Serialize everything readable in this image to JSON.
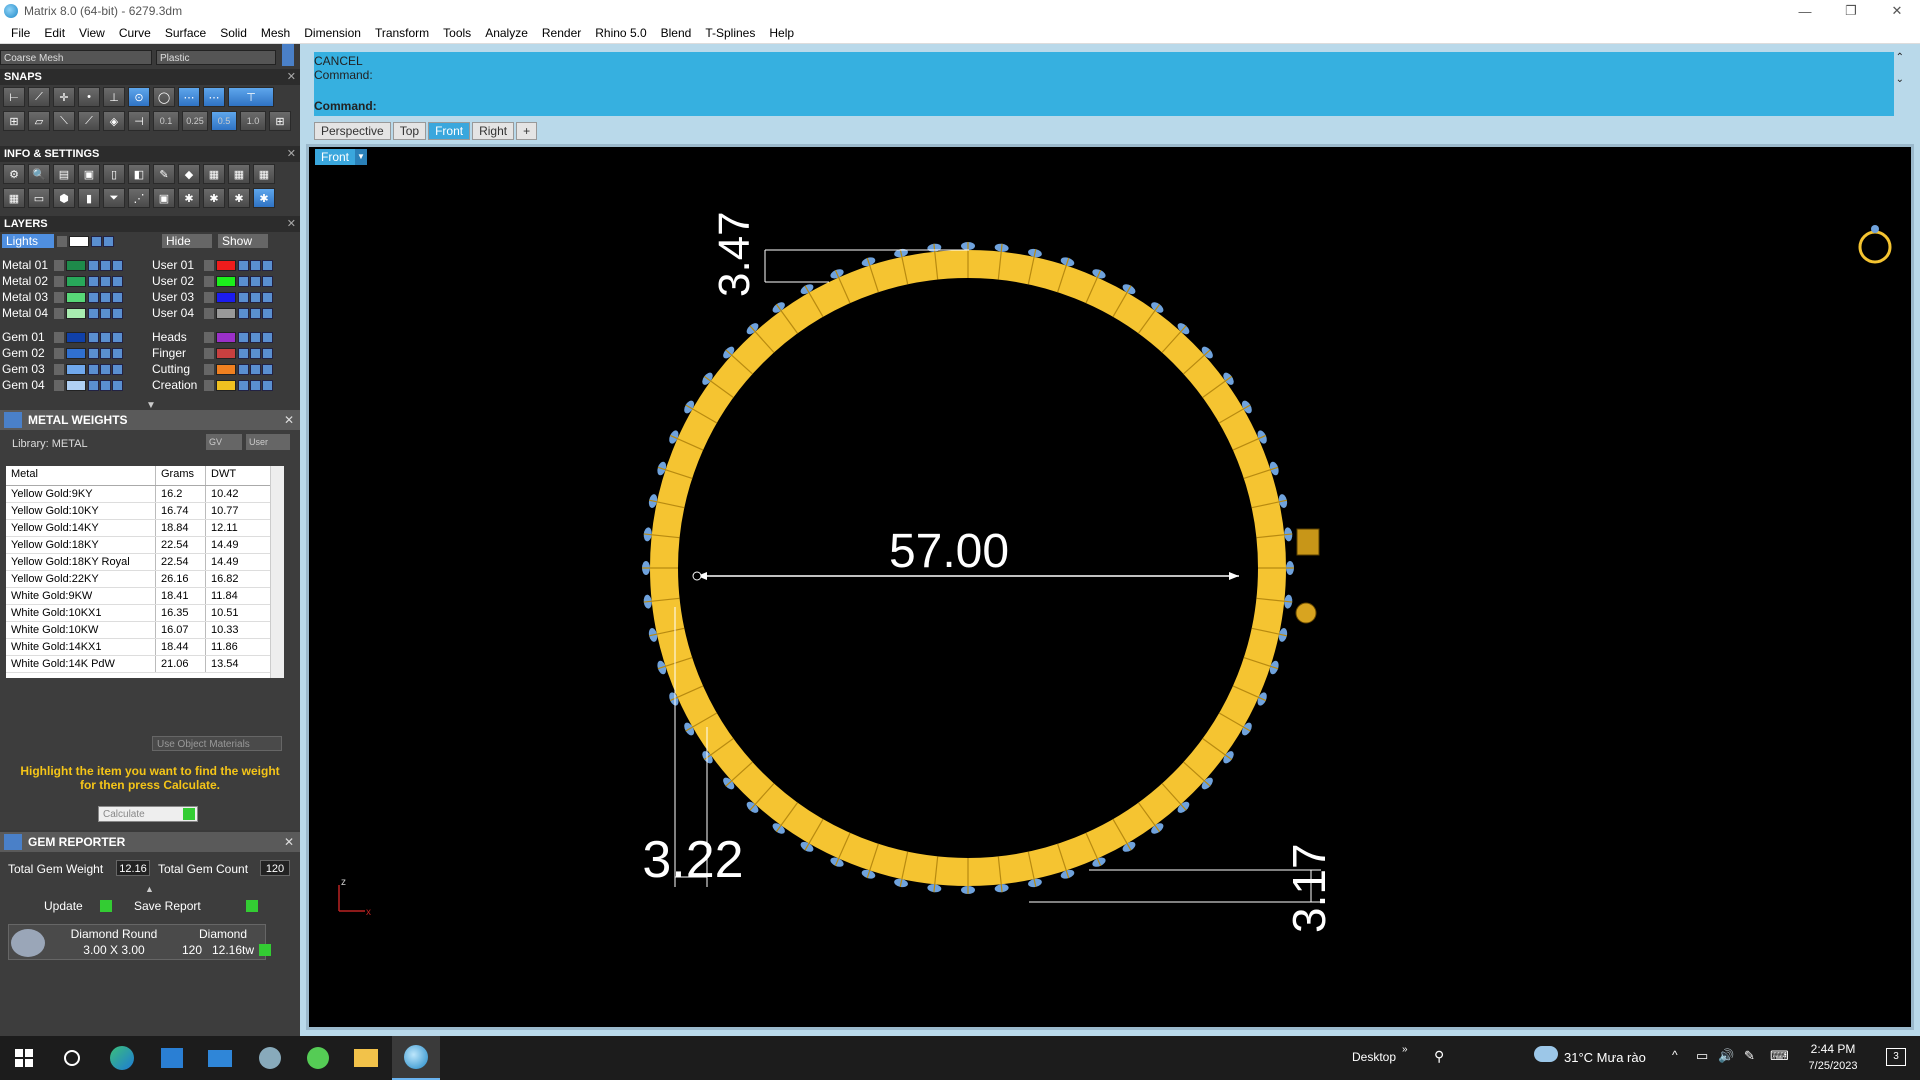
{
  "window": {
    "title": "Matrix 8.0 (64-bit) - 6279.3dm",
    "btn_min": "—",
    "btn_max": "❐",
    "btn_close": "✕"
  },
  "menu": [
    "File",
    "Edit",
    "View",
    "Curve",
    "Surface",
    "Solid",
    "Mesh",
    "Dimension",
    "Transform",
    "Tools",
    "Analyze",
    "Render",
    "Rhino 5.0",
    "Blend",
    "T-Splines",
    "Help"
  ],
  "top_combos": {
    "mesh": "Coarse Mesh",
    "material": "Plastic"
  },
  "snaps": {
    "title": "SNAPS",
    "values": [
      "0.1",
      "0.25",
      "0.5",
      "1.0"
    ]
  },
  "info": {
    "title": "INFO & SETTINGS"
  },
  "layers": {
    "title": "LAYERS",
    "lights": "Lights",
    "hide": "Hide",
    "show": "Show",
    "left": [
      {
        "name": "Metal 01",
        "color": "#1e8a4a"
      },
      {
        "name": "Metal 02",
        "color": "#28a85a"
      },
      {
        "name": "Metal 03",
        "color": "#58d878"
      },
      {
        "name": "Metal 04",
        "color": "#a8ecb0"
      },
      {
        "name": "Gem 01",
        "color": "#1040a8"
      },
      {
        "name": "Gem 02",
        "color": "#3070d0"
      },
      {
        "name": "Gem 03",
        "color": "#70a8ec"
      },
      {
        "name": "Gem 04",
        "color": "#b0d0f4"
      }
    ],
    "right": [
      {
        "name": "User 01",
        "color": "#ee1c1c"
      },
      {
        "name": "User 02",
        "color": "#1cee1c"
      },
      {
        "name": "User 03",
        "color": "#1c1cee"
      },
      {
        "name": "User 04",
        "color": "#999999"
      },
      {
        "name": "Heads",
        "color": "#9a30c8"
      },
      {
        "name": "Finger",
        "color": "#c84040"
      },
      {
        "name": "Cutting",
        "color": "#f08020"
      },
      {
        "name": "Creation",
        "color": "#f0c020"
      }
    ]
  },
  "metal_weights": {
    "title": "METAL WEIGHTS",
    "library": "Library: METAL",
    "gv": "GV",
    "user": "User",
    "headers": [
      "Metal",
      "Grams",
      "DWT"
    ],
    "rows": [
      [
        "Yellow Gold:9KY",
        "16.2",
        "10.42"
      ],
      [
        "Yellow Gold:10KY",
        "16.74",
        "10.77"
      ],
      [
        "Yellow Gold:14KY",
        "18.84",
        "12.11"
      ],
      [
        "Yellow Gold:18KY",
        "22.54",
        "14.49"
      ],
      [
        "Yellow Gold:18KY Royal",
        "22.54",
        "14.49"
      ],
      [
        "Yellow Gold:22KY",
        "26.16",
        "16.82"
      ],
      [
        "White Gold:9KW",
        "18.41",
        "11.84"
      ],
      [
        "White Gold:10KX1",
        "16.35",
        "10.51"
      ],
      [
        "White Gold:10KW",
        "16.07",
        "10.33"
      ],
      [
        "White Gold:14KX1",
        "18.44",
        "11.86"
      ],
      [
        "White Gold:14K PdW",
        "21.06",
        "13.54"
      ]
    ],
    "use_object_materials": "Use Object Materials",
    "hint": "Highlight the item you want to find the weight for then press Calculate.",
    "calculate": "Calculate"
  },
  "gem_reporter": {
    "title": "GEM REPORTER",
    "total_weight_label": "Total Gem Weight",
    "total_weight": "12.16",
    "total_count_label": "Total Gem Count",
    "total_count": "120",
    "update": "Update",
    "save_report": "Save Report",
    "gem_shape": "Diamond Round",
    "gem_type": "Diamond",
    "gem_size": "3.00 X 3.00",
    "gem_count": "120",
    "gem_weight": "12.16tw"
  },
  "command": {
    "line1": "CANCEL",
    "line2": "Command:",
    "prompt": "Command:"
  },
  "viewport_tabs": [
    "Perspective",
    "Top",
    "Front",
    "Right",
    "+"
  ],
  "active_view": "Front",
  "viewport": {
    "label": "Front",
    "dim_diameter": "57.00",
    "dim_top": "3.47",
    "dim_bottom_left": "3.22",
    "dim_bottom_right": "3.17",
    "axis_z": "z",
    "axis_x": "x",
    "ring_color": "#f5c431",
    "gem_color": "#6fa2dc"
  },
  "taskbar": {
    "desktop": "Desktop",
    "weather": "31°C  Mưa rào",
    "time": "2:44 PM",
    "date": "7/25/2023",
    "notif": "3"
  }
}
